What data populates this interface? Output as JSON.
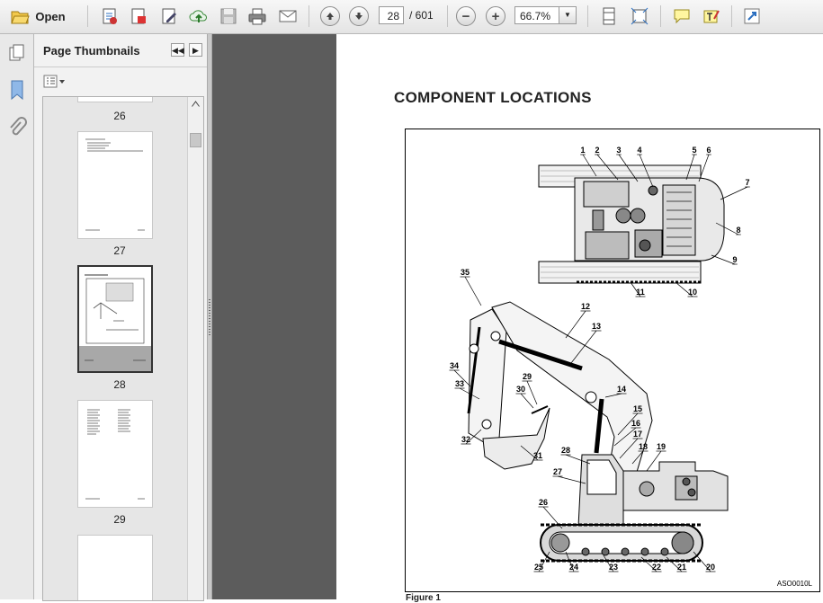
{
  "toolbar": {
    "open_label": "Open",
    "current_page": "28",
    "page_total": "/ 601",
    "zoom": "66.7%",
    "icons": [
      "open-folder-icon",
      "create-pdf-icon",
      "export-pdf-icon",
      "edit-icon",
      "upload-icon",
      "save-icon",
      "print-icon",
      "email-icon",
      "prev-page-icon",
      "next-page-icon",
      "zoom-out-icon",
      "zoom-in-icon",
      "fit-page-icon",
      "full-screen-icon",
      "comment-icon",
      "highlight-icon",
      "expand-icon"
    ]
  },
  "sidebar": {
    "panel_title": "Page Thumbnails",
    "tools": [
      "pages-icon",
      "bookmark-icon",
      "attachment-icon"
    ]
  },
  "thumbnails": [
    {
      "page": "26",
      "selected": false
    },
    {
      "page": "27",
      "selected": false
    },
    {
      "page": "28",
      "selected": true
    },
    {
      "page": "29",
      "selected": false
    }
  ],
  "document": {
    "heading": "COMPONENT LOCATIONS",
    "figure_code": "ASO0010L",
    "figure_caption": "Figure 1",
    "callouts": [
      "1",
      "2",
      "3",
      "4",
      "5",
      "6",
      "7",
      "8",
      "9",
      "10",
      "11",
      "12",
      "13",
      "14",
      "15",
      "16",
      "17",
      "18",
      "19",
      "20",
      "21",
      "22",
      "23",
      "24",
      "25",
      "26",
      "27",
      "28",
      "29",
      "30",
      "31",
      "32",
      "33",
      "34",
      "35"
    ]
  }
}
